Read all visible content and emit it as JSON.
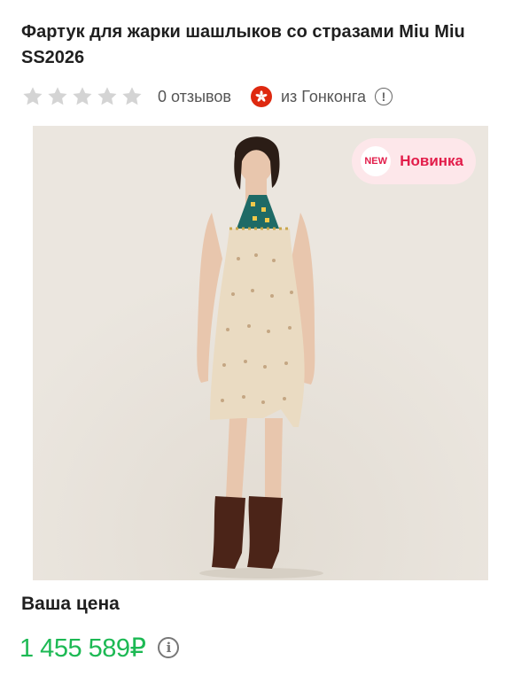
{
  "product": {
    "title": "Фартук для жарки шашлыков со стразами Miu Miu SS2026"
  },
  "rating": {
    "stars_filled": 0,
    "stars_total": 5,
    "reviews_text": "0 отзывов"
  },
  "origin": {
    "flag_icon": "hong-kong-flag-icon",
    "text": "из Гонконга",
    "info_icon": "info-icon"
  },
  "image": {
    "badge_circle": "NEW",
    "badge_label": "Новинка"
  },
  "price": {
    "caption": "Ваша цена",
    "value": "1 455 589₽",
    "info_icon": "info-icon"
  },
  "colors": {
    "price": "#1db954",
    "badge_text": "#e21d4a",
    "badge_bg": "#fde7ea",
    "star": "#d4d4d4"
  }
}
